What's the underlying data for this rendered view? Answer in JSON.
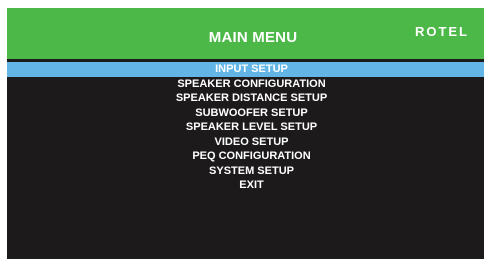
{
  "header": {
    "title": "MAIN MENU",
    "brand": "ROTEL"
  },
  "menu": {
    "selected_index": 0,
    "items": [
      {
        "label": "INPUT SETUP"
      },
      {
        "label": "SPEAKER CONFIGURATION"
      },
      {
        "label": "SPEAKER DISTANCE SETUP"
      },
      {
        "label": "SUBWOOFER SETUP"
      },
      {
        "label": "SPEAKER LEVEL SETUP"
      },
      {
        "label": "VIDEO SETUP"
      },
      {
        "label": "PEQ CONFIGURATION"
      },
      {
        "label": "SYSTEM SETUP"
      },
      {
        "label": "EXIT"
      }
    ]
  },
  "colors": {
    "header_bg": "#4cb848",
    "screen_bg": "#1c1a1b",
    "highlight": "#62b5e5",
    "text": "#ffffff"
  }
}
